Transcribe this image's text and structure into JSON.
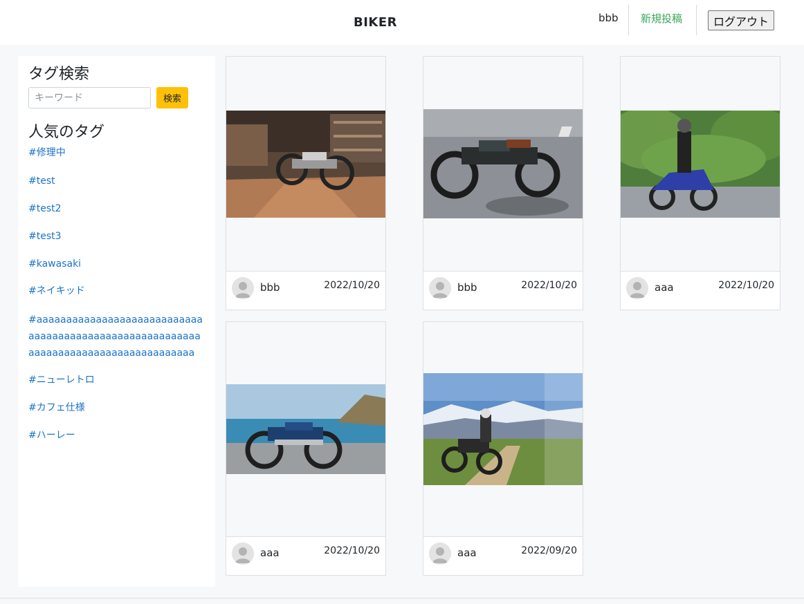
{
  "header": {
    "brand": "BIKER",
    "user_name": "bbb",
    "new_post_label": "新規投稿",
    "logout_label": "ログアウト"
  },
  "sidebar": {
    "search_title": "タグ検索",
    "search_placeholder": "キーワード",
    "search_button": "検索",
    "popular_title": "人気のタグ",
    "tags": [
      "#修理中",
      "#test",
      "#test2",
      "#test3",
      "#kawasaki",
      "#ネイキッド",
      "#aaaaaaaaaaaaaaaaaaaaaaaaaaaaaaaaaaaaaaaaaaaaaaaaaaaaaaaaaaaaaaaaaaaaaaaaaaaaaaaaaaaaa",
      "#ニューレトロ",
      "#カフェ仕様",
      "#ハーレー"
    ]
  },
  "posts": [
    {
      "user": "bbb",
      "date": "2022/10/20",
      "image": "garage-cafe-racer-photo"
    },
    {
      "user": "bbb",
      "date": "2022/10/20",
      "image": "black-cafe-racer-photo"
    },
    {
      "user": "aaa",
      "date": "2022/10/20",
      "image": "blue-sport-bike-rider-photo"
    },
    {
      "user": "aaa",
      "date": "2022/10/20",
      "image": "blue-retro-bike-seaside-photo"
    },
    {
      "user": "aaa",
      "date": "2022/09/20",
      "image": "adventure-bike-mountains-photo"
    }
  ],
  "colors": {
    "accent_link": "#1a73c9",
    "new_post": "#3aa757",
    "search_button": "#ffc107",
    "background": "#f7f8fa"
  }
}
